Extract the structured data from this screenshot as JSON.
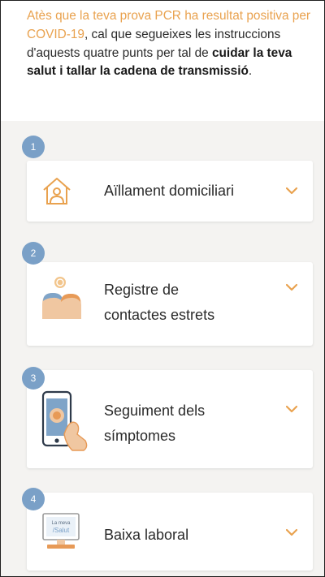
{
  "intro": {
    "part1": "Atès que la teva prova PCR ha resultat positiva per COVID-19",
    "part2": ", cal que segueixes les instruccions d'aquests quatre punts per tal de ",
    "part3": "cuidar la teva salut i tallar la cadena de transmissió",
    "part4": "."
  },
  "steps": [
    {
      "number": "1",
      "label_line1": "Aïllament domiciliari",
      "label_line2": "",
      "icon": "home-person-icon"
    },
    {
      "number": "2",
      "label_line1": "Registre de",
      "label_line2": "contactes estrets",
      "icon": "contacts-people-icon"
    },
    {
      "number": "3",
      "label_line1": "Seguiment dels",
      "label_line2": "símptomes",
      "icon": "phone-symptoms-icon"
    },
    {
      "number": "4",
      "label_line1": "Baixa laboral",
      "label_line2": "",
      "icon": "la-meva-salut-monitor-icon",
      "icon_text_1": "La meva",
      "icon_text_2": "/Salut"
    }
  ],
  "colors": {
    "accent_orange": "#e9a24f",
    "badge_blue": "#7aa0c7",
    "text_dark": "#2a2a2a"
  },
  "icons": {
    "expand": "chevron-down-icon"
  }
}
